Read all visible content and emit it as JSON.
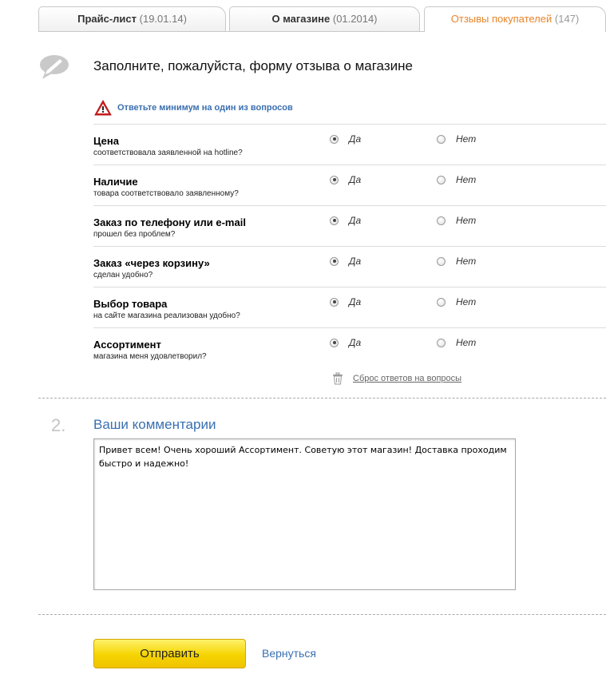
{
  "tabs": [
    {
      "label": "Прайс-лист",
      "date": "(19.01.14)"
    },
    {
      "label": "О магазине",
      "date": "(01.2014)"
    },
    {
      "label": "Отзывы покупателей",
      "date": "(147)"
    }
  ],
  "header": {
    "title": "Заполните, пожалуйста, форму отзыва о магазине"
  },
  "warning": {
    "text": "Ответьте минимум на один из вопросов"
  },
  "options": {
    "yes": "Да",
    "no": "Нет"
  },
  "questions": [
    {
      "title": "Цена",
      "subtitle": "соответствовала заявленной на hotline?",
      "answer": "yes"
    },
    {
      "title": "Наличие",
      "subtitle": "товара соответствовало заявленному?",
      "answer": "yes"
    },
    {
      "title": "Заказ по телефону или e-mail",
      "subtitle": "прошел без проблем?",
      "answer": "yes"
    },
    {
      "title": "Заказ «через корзину»",
      "subtitle": "сделан удобно?",
      "answer": "yes"
    },
    {
      "title": "Выбор товара",
      "subtitle": "на сайте магазина реализован удобно?",
      "answer": "yes"
    },
    {
      "title": "Ассортимент",
      "subtitle": "магазина меня удовлетворил?",
      "answer": "yes"
    }
  ],
  "reset": {
    "label": "Сброс ответов на вопросы"
  },
  "comments": {
    "step": "2.",
    "title": "Ваши комментарии",
    "value": "Привет всем! Очень хороший Ассортимент. Советую этот магазин! Доставка проходим быстро и надежно!"
  },
  "actions": {
    "submit": "Отправить",
    "back": "Вернуться"
  },
  "colors": {
    "accent": "#3a6fb0",
    "active_tab": "#e8852a",
    "button": "#f5d400",
    "warning": "#d21f1f"
  }
}
